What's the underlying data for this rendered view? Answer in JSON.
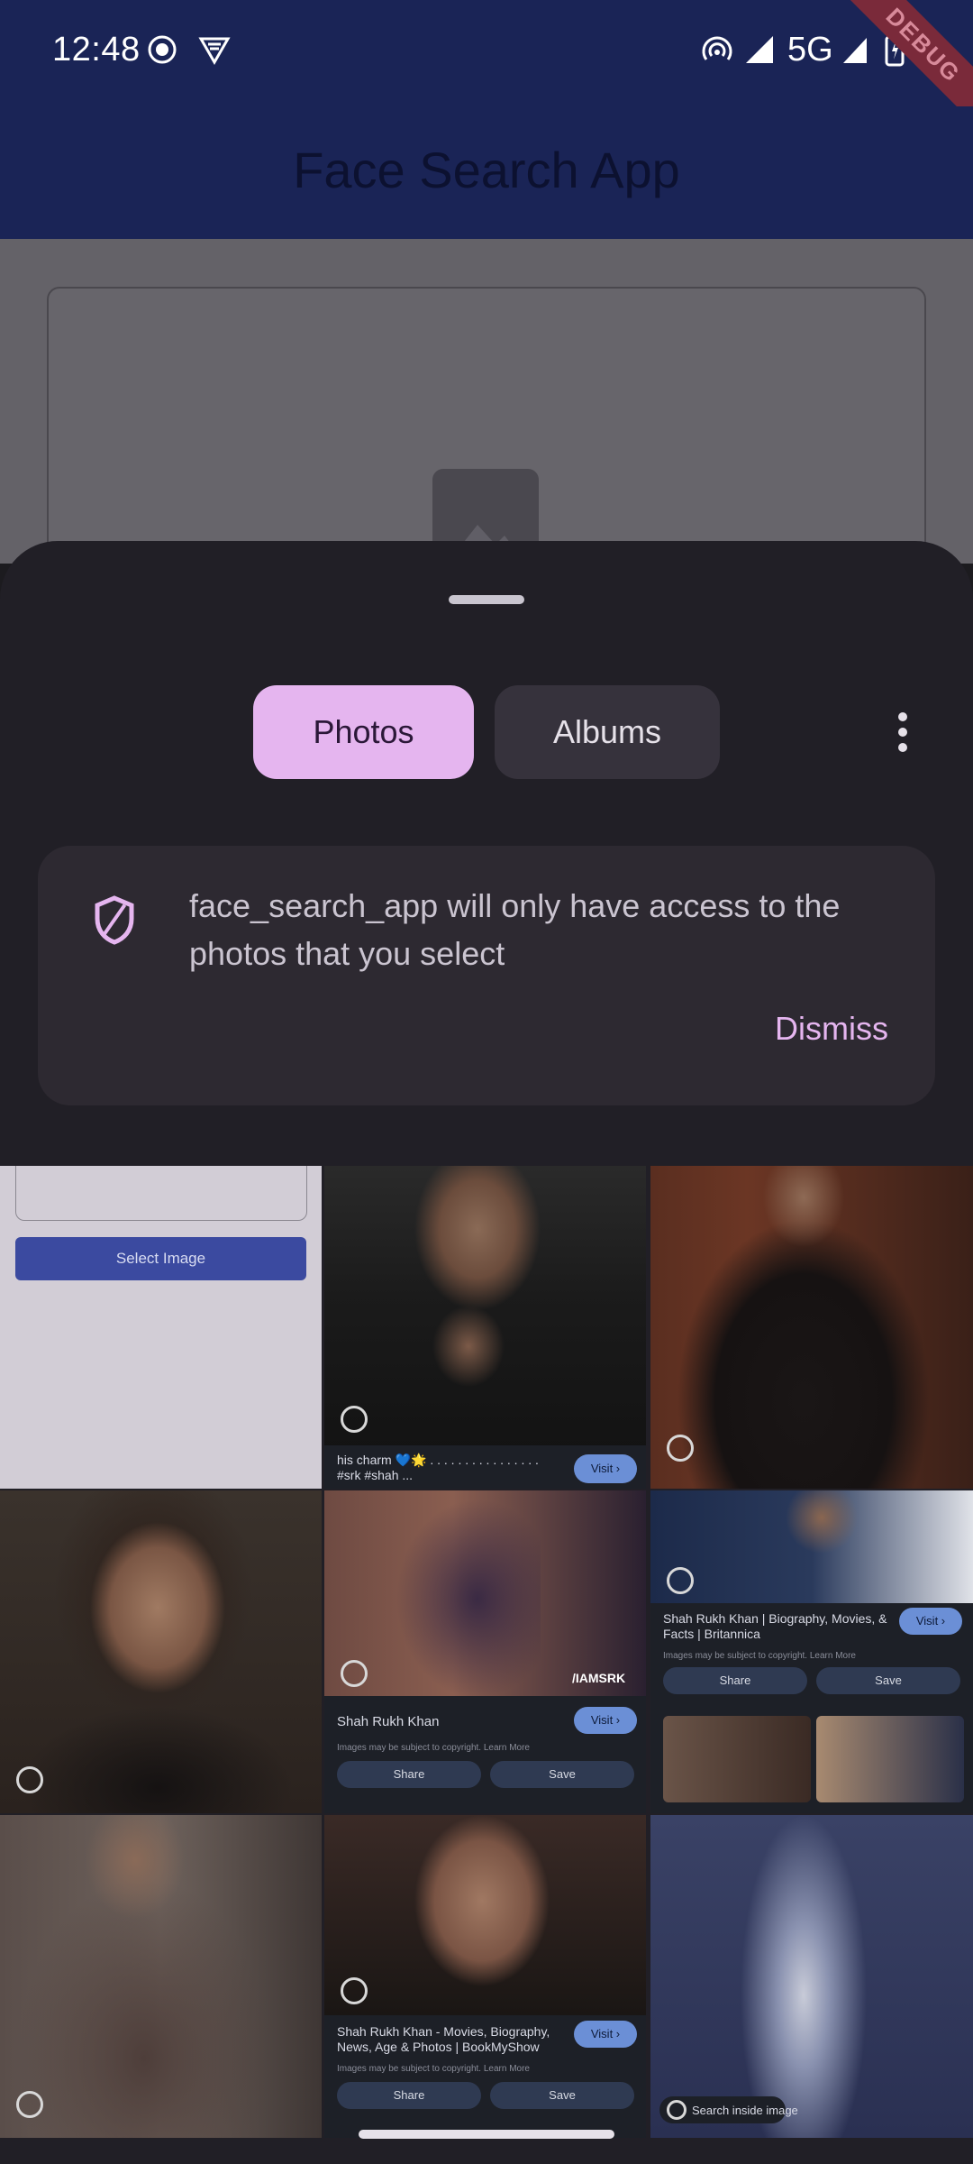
{
  "status_bar": {
    "time": "12:48",
    "network": "5G",
    "icons": [
      "hotspot-icon",
      "signal-icon",
      "battery-icon",
      "vpn-icon",
      "record-icon"
    ]
  },
  "debug_banner": "DEBUG",
  "app": {
    "title": "Face Search App"
  },
  "picker": {
    "tabs": [
      {
        "label": "Photos",
        "selected": true
      },
      {
        "label": "Albums",
        "selected": false
      }
    ],
    "notice": {
      "message": "face_search_app will only have access to the photos that you select",
      "dismiss_label": "Dismiss"
    }
  },
  "grid": {
    "select_button": "Select Image",
    "c1_caption": "his charm 💙🌟 . . . . . . . . . . . . . . . . #srk #shah ...",
    "c1_visit": "Visit ›",
    "c4_title": "Shah Rukh Khan",
    "c4_copyright": "Images may be subject to copyright. Learn More",
    "c4_visit": "Visit ›",
    "c4_share": "Share",
    "c4_save": "Save",
    "c4_watermark": "/IAMSRK",
    "c5_title": "Shah Rukh Khan | Biography, Movies, & Facts | Britannica",
    "c5_copyright": "Images may be subject to copyright. Learn More",
    "c5_visit": "Visit ›",
    "c5_share": "Share",
    "c5_save": "Save",
    "c7_title": "Shah Rukh Khan - Movies, Biography, News, Age & Photos | BookMyShow",
    "c7_copyright": "Images may be subject to copyright. Learn More",
    "c7_visit": "Visit ›",
    "c7_share": "Share",
    "c7_save": "Save",
    "c8_search_inside": "Search inside image"
  },
  "colors": {
    "status_bar": "#1a2456",
    "sheet": "#211f26",
    "accent": "#e5b5ef"
  }
}
